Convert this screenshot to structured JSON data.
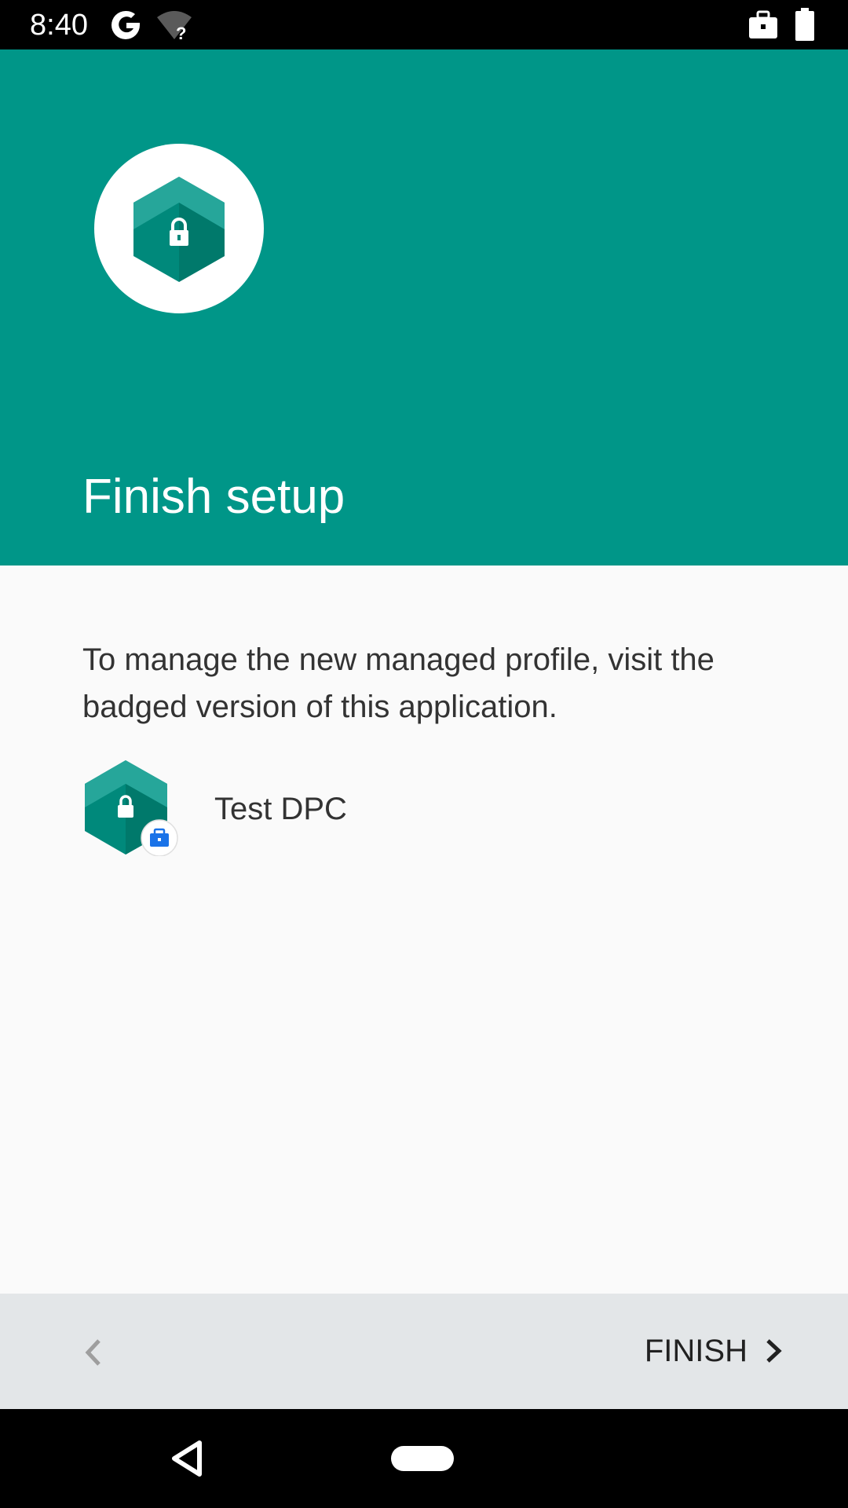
{
  "status_bar": {
    "time": "8:40",
    "icons": [
      "google-g-icon",
      "wifi-unknown-icon",
      "work-profile-icon",
      "battery-icon"
    ]
  },
  "header": {
    "title": "Finish setup",
    "background_color": "#009688",
    "app_icon": "test-dpc-app-icon"
  },
  "main": {
    "description": "To manage the new managed profile, visit the badged version of this application.",
    "app_entry": {
      "label": "Test DPC",
      "icon": "test-dpc-app-icon",
      "badge": "work-briefcase-badge-icon"
    }
  },
  "footer": {
    "back_icon": "chevron-left-icon",
    "finish_label": "FINISH",
    "finish_icon": "chevron-right-icon"
  },
  "nav_bar": {
    "icons": [
      "nav-back-icon",
      "nav-home-pill"
    ]
  }
}
